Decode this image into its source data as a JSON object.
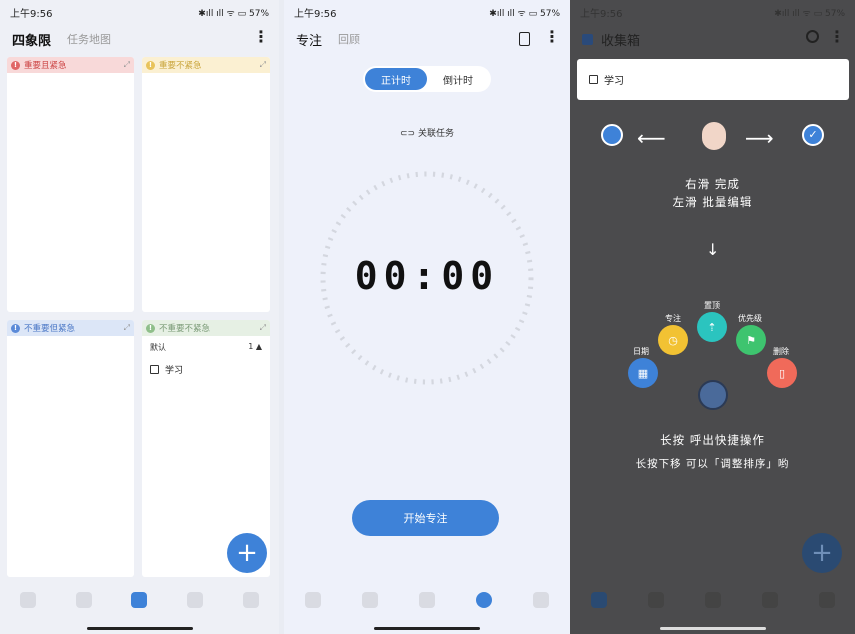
{
  "screen1": {
    "status_time": "上午9:56",
    "status_right": "✱ıll ıll ᯤ ▭ 57%",
    "title": "四象限",
    "subtab": "任务地图",
    "quadrants": [
      {
        "label": "重要且紧急",
        "dot_color": "#e06666",
        "head_bg": "#f8d9d9"
      },
      {
        "label": "重要不紧急",
        "dot_color": "#e8c35a",
        "head_bg": "#fbf0d2"
      },
      {
        "label": "不重要但紧急",
        "dot_color": "#5b8ad8",
        "head_bg": "#dce6f7"
      },
      {
        "label": "不重要不紧急",
        "dot_color": "#8fbf8a",
        "head_bg": "#e6f0e4"
      }
    ],
    "group_label": "默认",
    "group_count": "1 ▲",
    "task": "学习",
    "fab": "+"
  },
  "screen2": {
    "status_time": "上午9:56",
    "status_right": "✱ıll ıll ᯤ ▭ 57%",
    "title": "专注",
    "subtab": "回顾",
    "seg_on": "正计时",
    "seg_off": "倒计时",
    "link_task": "关联任务",
    "timer": "00:00",
    "start_button": "开始专注"
  },
  "screen3": {
    "status_time": "上午9:56",
    "status_right": "✱ıll ıll ᯤ ▭ 57%",
    "title": "收集箱",
    "task": "学习",
    "hint1": "右滑 完成",
    "hint2": "左滑 批量编辑",
    "fan_labels": [
      "日期",
      "专注",
      "置顶",
      "优先级",
      "删除"
    ],
    "hint3": "长按 呼出快捷操作",
    "hint4": "长按下移 可以「调整排序」哟",
    "fab": "+"
  },
  "colors": {
    "accent": "#3e82d8",
    "dark_bg": "#4b4b4d"
  }
}
